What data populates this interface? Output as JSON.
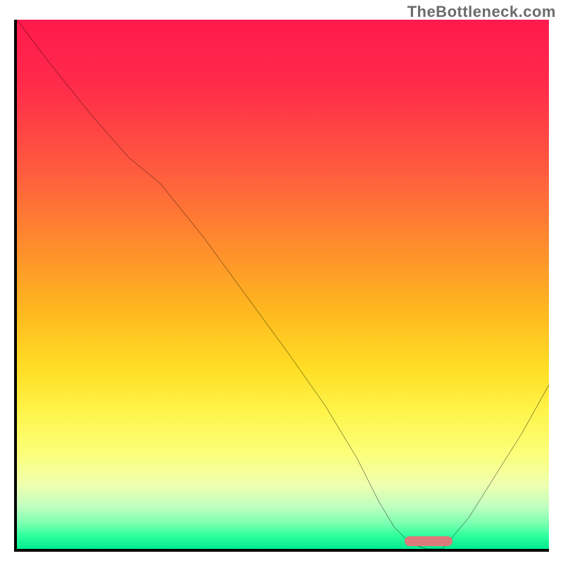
{
  "watermark": "TheBottleneck.com",
  "colors": {
    "axis": "#000000",
    "curve": "#000000",
    "marker": "#dd7a7a",
    "watermark_text": "#6b6b6b",
    "gradient_top": "#ff1a4d",
    "gradient_bottom": "#00eb8f"
  },
  "chart_data": {
    "type": "line",
    "title": "",
    "xlabel": "",
    "ylabel": "",
    "xlim": [
      0,
      100
    ],
    "ylim": [
      0,
      100
    ],
    "grid": false,
    "legend": false,
    "series": [
      {
        "name": "bottleneck-curve",
        "x": [
          0,
          6,
          14,
          21,
          27,
          35,
          43,
          51,
          58,
          64,
          68,
          71,
          74,
          77,
          80,
          85,
          90,
          95,
          100
        ],
        "y": [
          100,
          92,
          82,
          74,
          69,
          59,
          48,
          37,
          27,
          17,
          9,
          4,
          1,
          0,
          0,
          6,
          14,
          22,
          31
        ]
      }
    ],
    "marker": {
      "name": "optimal-range",
      "x_start": 73,
      "x_end": 82,
      "color": "#dd7a7a"
    },
    "background": "vertical-gradient red→orange→yellow→green"
  }
}
